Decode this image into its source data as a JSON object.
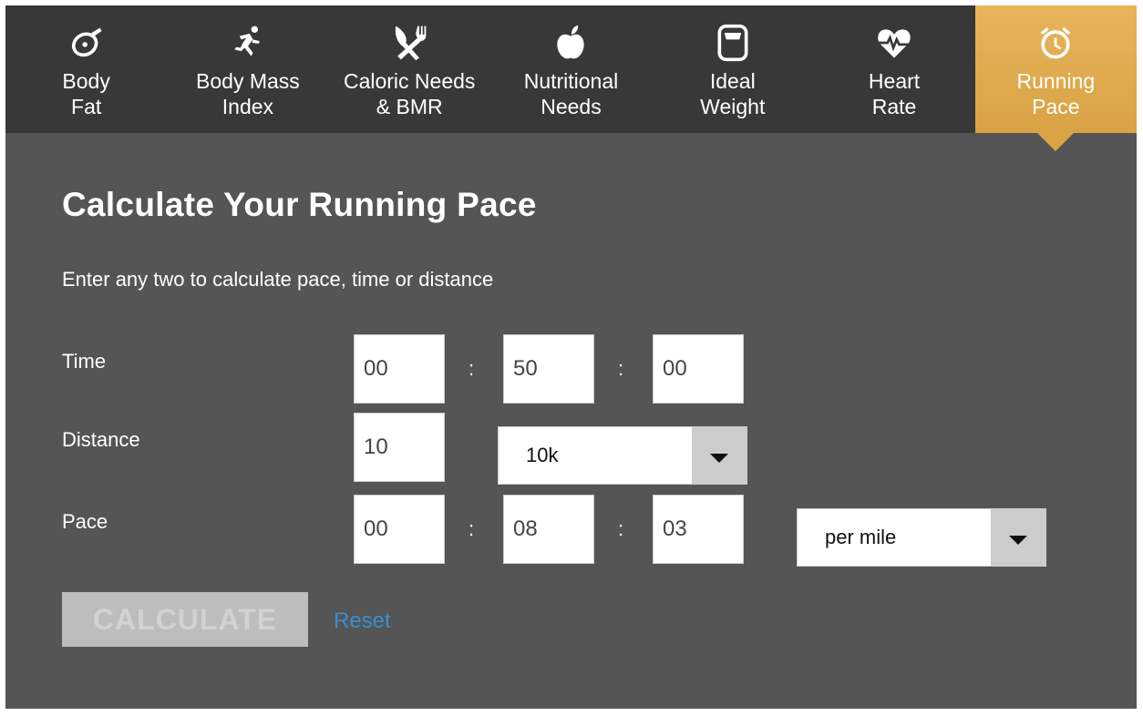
{
  "tabs": [
    {
      "label": "Body\nFat",
      "icon": "tape-measure-icon",
      "active": false
    },
    {
      "label": "Body Mass\nIndex",
      "icon": "runner-icon",
      "active": false
    },
    {
      "label": "Caloric Needs\n& BMR",
      "icon": "fork-knife-icon",
      "active": false
    },
    {
      "label": "Nutritional\nNeeds",
      "icon": "apple-icon",
      "active": false
    },
    {
      "label": "Ideal\nWeight",
      "icon": "scale-icon",
      "active": false
    },
    {
      "label": "Heart\nRate",
      "icon": "heartbeat-icon",
      "active": false
    },
    {
      "label": "Running\nPace",
      "icon": "alarm-clock-icon",
      "active": true
    }
  ],
  "page": {
    "title": "Calculate Your Running Pace",
    "instruction": "Enter any two to calculate pace, time or distance"
  },
  "time": {
    "label": "Time",
    "hours": "00",
    "minutes": "50",
    "seconds": "00",
    "separator": ":"
  },
  "distance": {
    "label": "Distance",
    "value": "10",
    "unit": "10k"
  },
  "pace": {
    "label": "Pace",
    "hours": "00",
    "minutes": "08",
    "seconds": "03",
    "unit": "per mile"
  },
  "actions": {
    "calculate": "CALCULATE",
    "reset": "Reset"
  },
  "colors": {
    "active_tab": "#e0ab4f",
    "nav_bg": "#383838",
    "panel_bg": "#555555",
    "link": "#3a8fd1"
  }
}
